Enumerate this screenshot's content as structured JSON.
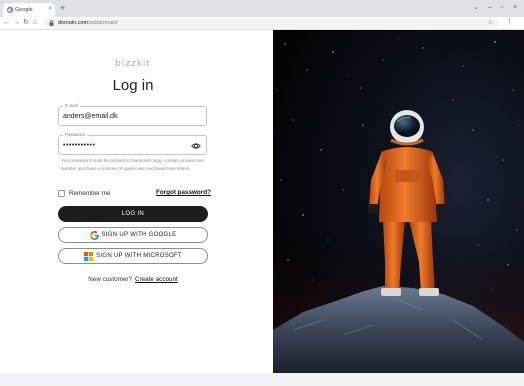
{
  "browser": {
    "tab_title": "Google",
    "tab_close": "×",
    "new_tab": "+",
    "url_domain": "domain.com",
    "url_path": "/subdomain/",
    "icons": [
      "google-favicon",
      "back-arrow-icon",
      "forward-arrow-icon",
      "reload-icon",
      "home-icon",
      "lock-icon",
      "star-icon",
      "more-vert-icon",
      "chevron-down-icon",
      "minimize-icon",
      "maximize-icon",
      "close-icon"
    ]
  },
  "brand": "bizzkit",
  "login": {
    "title": "Log in",
    "email_label": "E-mail",
    "email_value": "anders@email.dk",
    "password_label": "Password",
    "password_value": "•••••••••••",
    "password_hint": "Your password must be at least 8 characters long, contain at least one number and have a mixture of uppercase and lowercase letters.",
    "remember_label": "Remember me",
    "forgot_label": "Forgot password?",
    "login_button": "LOG IN",
    "google_button": "SIGN UP WITH GOOGLE",
    "microsoft_button": "SIGN UP WITH MICROSOFT",
    "new_customer": "New customer?",
    "create_account": "Create account"
  },
  "colors": {
    "primary_button": "#1d1d1f",
    "suit": "#e8641f",
    "sky": "#05070c"
  }
}
